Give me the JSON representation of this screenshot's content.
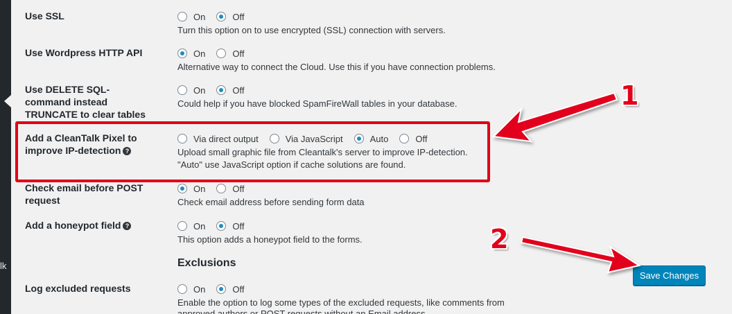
{
  "sidebar": {
    "partial_text": "lk"
  },
  "settings": [
    {
      "label": "Use SSL",
      "options": [
        "On",
        "Off"
      ],
      "selected": 1,
      "description": "Turn this option on to use encrypted (SSL) connection with servers."
    },
    {
      "label": "Use Wordpress HTTP API",
      "options": [
        "On",
        "Off"
      ],
      "selected": 0,
      "description": "Alternative way to connect the Cloud. Use this if you have connection problems."
    },
    {
      "label": "Use DELETE SQL-command instead TRUNCATE to clear tables",
      "options": [
        "On",
        "Off"
      ],
      "selected": 1,
      "description": "Could help if you have blocked SpamFireWall tables in your database."
    },
    {
      "label": "Add a CleanTalk Pixel to improve IP-detection",
      "has_help_icon": true,
      "options": [
        "Via direct output",
        "Via JavaScript",
        "Auto",
        "Off"
      ],
      "selected": 2,
      "description": "Upload small graphic file from Cleantalk's server to improve IP-detection.",
      "description2": "\"Auto\" use JavaScript option if cache solutions are found."
    },
    {
      "label": "Check email before POST request",
      "options": [
        "On",
        "Off"
      ],
      "selected": 0,
      "description": "Check email address before sending form data"
    },
    {
      "label": "Add a honeypot field",
      "has_help_icon": true,
      "options": [
        "On",
        "Off"
      ],
      "selected": 1,
      "description": "This option adds a honeypot field to the forms."
    }
  ],
  "exclusions": {
    "title": "Exclusions",
    "log_excluded": {
      "label": "Log excluded requests",
      "options": [
        "On",
        "Off"
      ],
      "selected": 1,
      "description": "Enable the option to log some types of the excluded requests, like comments from",
      "description_cut": "approved authors or POST requests without an Email address"
    }
  },
  "save_button": "Save Changes",
  "annotations": {
    "marker1": "1",
    "marker2": "2"
  },
  "colors": {
    "accent": "#0085ba",
    "highlight": "#e2001a",
    "radio_checked": "#1e8cbe"
  }
}
